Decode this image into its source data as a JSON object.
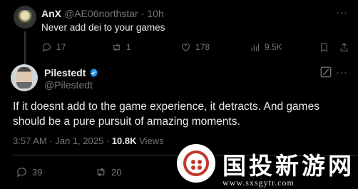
{
  "reply_tweet": {
    "author_name": "AnX",
    "handle": "@AE06northstar",
    "dot": "·",
    "time": "10h",
    "text": "Never add dei to your games",
    "more": "···",
    "metrics": {
      "replies": "17",
      "retweets": "1",
      "likes": "178",
      "views": "9.5K"
    }
  },
  "main_tweet": {
    "author_name": "Pilestedt",
    "handle": "@Pilestedt",
    "verified": true,
    "more": "···",
    "text": "If it doesnt add to the game experience, it detracts. And games should be a pure pursuit of amazing moments.",
    "timestamp": "3:57 AM · Jan 1, 2025",
    "dot": "·",
    "views_count": "10.8K",
    "views_label": "Views",
    "metrics": {
      "replies": "39",
      "retweets": "20"
    }
  },
  "watermark": {
    "title": "国投新游网",
    "url": "www.sxsgytr.com"
  },
  "colors": {
    "accent": "#1d9bf0",
    "muted": "#71767b",
    "text": "#e7e9ea",
    "bg": "#000000"
  }
}
